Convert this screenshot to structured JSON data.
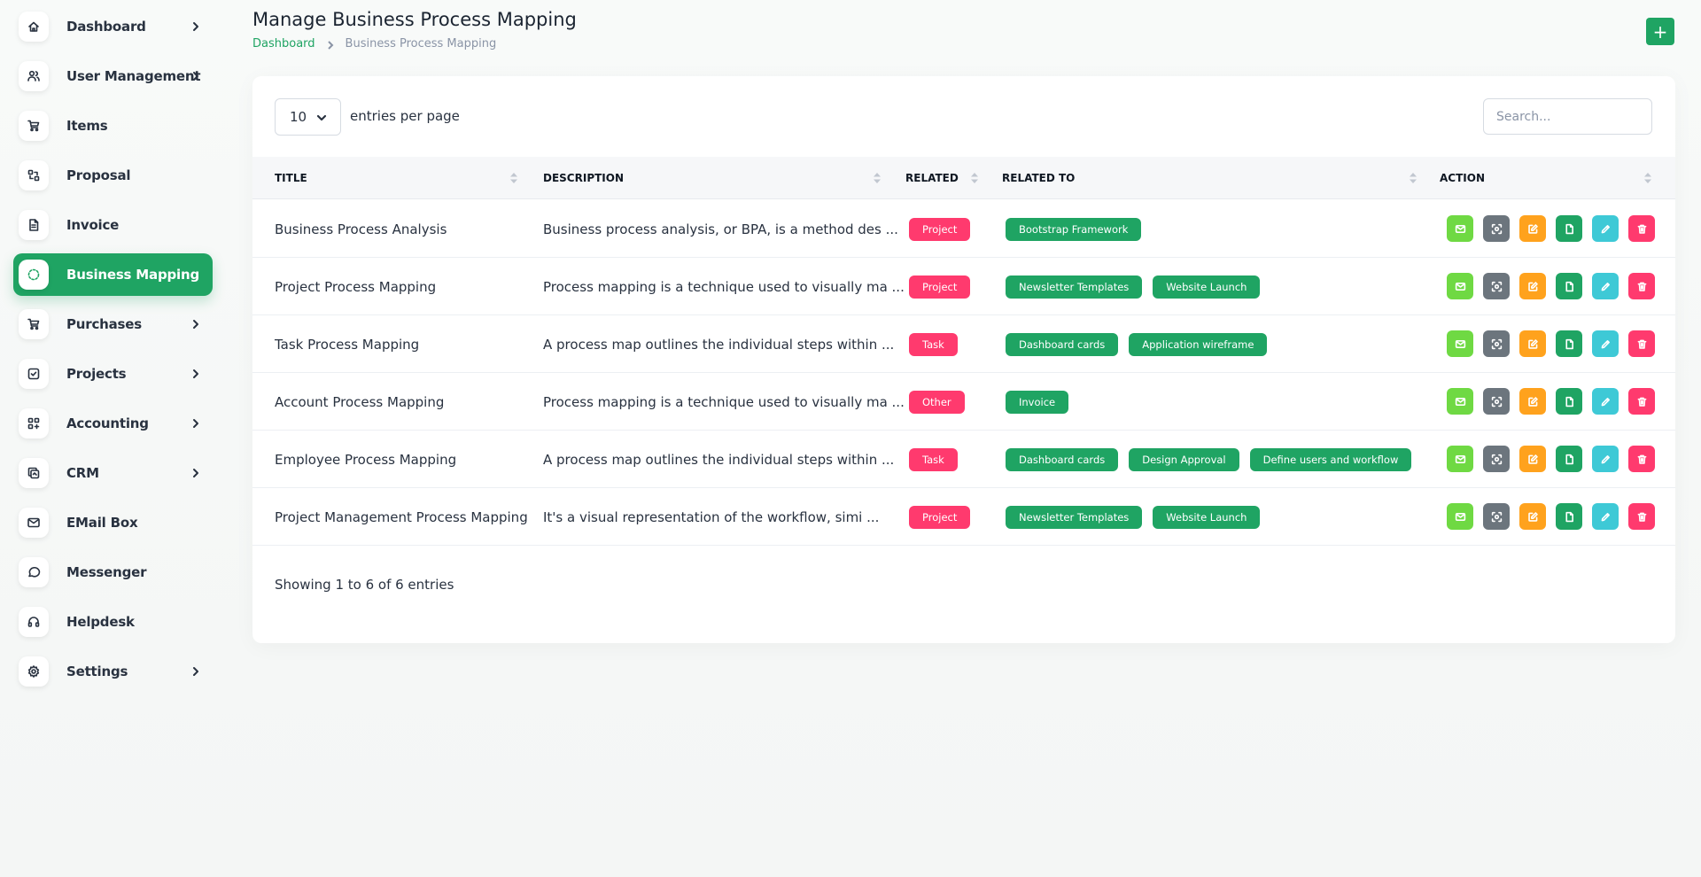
{
  "sidebar": {
    "items": [
      {
        "label": "Dashboard",
        "icon": "home-icon",
        "has_children": true,
        "active": false
      },
      {
        "label": "User Management",
        "icon": "users-icon",
        "has_children": true,
        "active": false
      },
      {
        "label": "Items",
        "icon": "cart-icon",
        "has_children": false,
        "active": false
      },
      {
        "label": "Proposal",
        "icon": "transfer-icon",
        "has_children": false,
        "active": false
      },
      {
        "label": "Invoice",
        "icon": "file-invoice-icon",
        "has_children": false,
        "active": false
      },
      {
        "label": "Business Mapping",
        "icon": "circle-dashed-icon",
        "has_children": false,
        "active": true
      },
      {
        "label": "Purchases",
        "icon": "shopping-cart-icon",
        "has_children": true,
        "active": false
      },
      {
        "label": "Projects",
        "icon": "checkbox-icon",
        "has_children": true,
        "active": false
      },
      {
        "label": "Accounting",
        "icon": "apps-plus-icon",
        "has_children": true,
        "active": false
      },
      {
        "label": "CRM",
        "icon": "layers-icon",
        "has_children": true,
        "active": false
      },
      {
        "label": "EMail Box",
        "icon": "mail-icon",
        "has_children": false,
        "active": false
      },
      {
        "label": "Messenger",
        "icon": "message-icon",
        "has_children": false,
        "active": false
      },
      {
        "label": "Helpdesk",
        "icon": "headphones-icon",
        "has_children": false,
        "active": false
      },
      {
        "label": "Settings",
        "icon": "settings-icon",
        "has_children": true,
        "active": false
      }
    ]
  },
  "header": {
    "title": "Manage Business Process Mapping",
    "breadcrumb": {
      "link": "Dashboard",
      "current": "Business Process Mapping"
    },
    "add_label": "+"
  },
  "table": {
    "entries_value": "10",
    "entries_label": "entries per page",
    "search_placeholder": "Search...",
    "columns": [
      "TITLE",
      "DESCRIPTION",
      "RELATED",
      "RELATED TO",
      "ACTION"
    ],
    "rows": [
      {
        "title": "Business Process Analysis",
        "description": "Business process analysis, or BPA, is a method des ...",
        "related": "Project",
        "related_to": [
          "Bootstrap Framework"
        ]
      },
      {
        "title": "Project Process Mapping",
        "description": "Process mapping is a technique used to visually ma ...",
        "related": "Project",
        "related_to": [
          "Newsletter Templates",
          "Website Launch"
        ]
      },
      {
        "title": "Task Process Mapping",
        "description": "A process map outlines the individual steps within ...",
        "related": "Task",
        "related_to": [
          "Dashboard cards",
          "Application wireframe"
        ]
      },
      {
        "title": "Account Process Mapping",
        "description": "Process mapping is a technique used to visually ma ...",
        "related": "Other",
        "related_to": [
          "Invoice"
        ]
      },
      {
        "title": "Employee Process Mapping",
        "description": "A process map outlines the individual steps within ...",
        "related": "Task",
        "related_to": [
          "Dashboard cards",
          "Design Approval",
          "Define users and workflow"
        ]
      },
      {
        "title": "Project Management Process Mapping",
        "description": "It's a visual representation of the workflow, simi ...",
        "related": "Project",
        "related_to": [
          "Newsletter Templates",
          "Website Launch"
        ]
      }
    ],
    "action_icons": [
      "mail-icon",
      "scan-icon",
      "edit-icon",
      "file-icon",
      "pencil-icon",
      "trash-icon"
    ],
    "footer": "Showing 1 to 6 of 6 entries"
  },
  "colors": {
    "accent": "#1fa463",
    "danger": "#ff3a6e",
    "mail": "#6fd943",
    "scan": "#6c757d",
    "edit": "#ffa21d",
    "pen": "#3ec9d6"
  }
}
